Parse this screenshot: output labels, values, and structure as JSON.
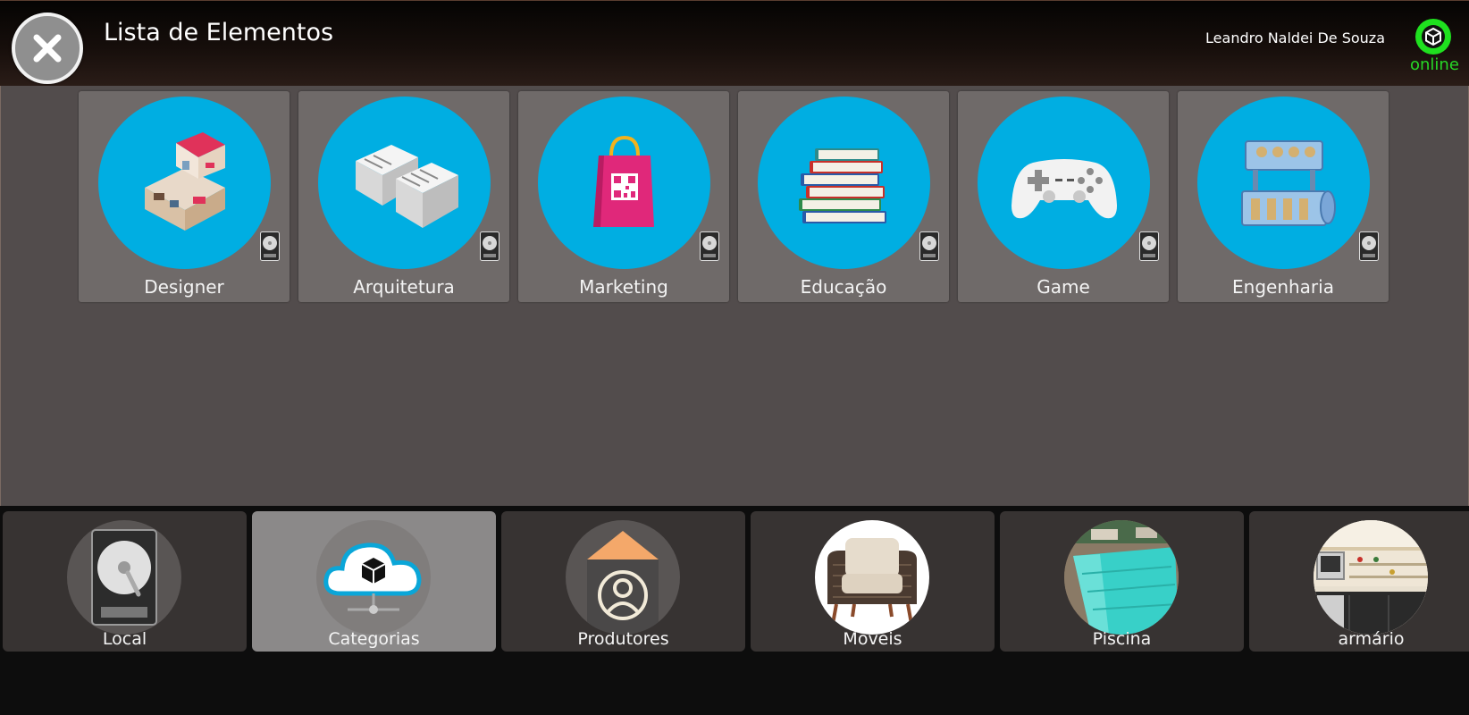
{
  "header": {
    "title": "Lista de Elementos",
    "close_icon": "close-icon",
    "user_name": "Leandro Naldei De Souza",
    "status_icon": "cube-icon",
    "status_text": "online",
    "status_color": "#1fe01f"
  },
  "categories": [
    {
      "label": "Designer",
      "icon": "house-cutaway-icon"
    },
    {
      "label": "Arquitetura",
      "icon": "apartment-model-icon"
    },
    {
      "label": "Marketing",
      "icon": "shopping-bag-qr-icon"
    },
    {
      "label": "Educação",
      "icon": "books-stack-icon"
    },
    {
      "label": "Game",
      "icon": "gamepad-icon"
    },
    {
      "label": "Engenharia",
      "icon": "engine-block-icon"
    }
  ],
  "category_badge_icon": "hard-drive-icon",
  "dock": {
    "items": [
      {
        "label": "Local",
        "icon": "hard-drive-icon",
        "active": false
      },
      {
        "label": "Categorias",
        "icon": "cloud-cube-icon",
        "active": true
      },
      {
        "label": "Produtores",
        "icon": "producer-profile-icon",
        "active": false
      },
      {
        "label": "Moveis",
        "icon": "armchair-icon",
        "active": false
      },
      {
        "label": "Piscina",
        "icon": "pool-icon",
        "active": false
      },
      {
        "label": "armário",
        "icon": "kitchen-cabinet-icon",
        "active": false
      }
    ]
  },
  "colors": {
    "accent_circle": "#00aee2",
    "card_bg": "#6f6a69",
    "panel_bg": "#524c4c",
    "dock_item_bg": "#373332",
    "dock_active_bg": "#8b8989"
  }
}
